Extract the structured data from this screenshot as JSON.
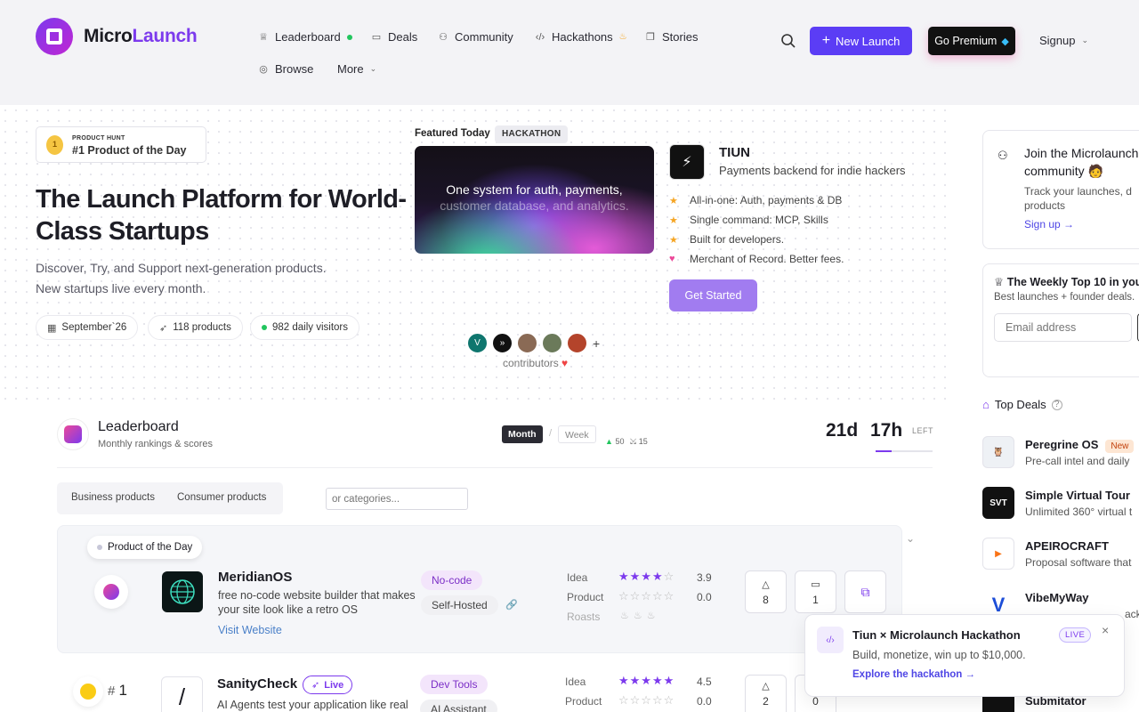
{
  "brand": {
    "name_a": "Micro",
    "name_b": "Launch"
  },
  "nav": {
    "leaderboard": "Leaderboard",
    "deals": "Deals",
    "community": "Community",
    "hackathons": "Hackathons",
    "stories": "Stories",
    "browse": "Browse",
    "more": "More"
  },
  "header_actions": {
    "new_launch": "New Launch",
    "premium": "Go Premium",
    "signup": "Signup"
  },
  "hero": {
    "badge_small": "PRODUCT HUNT",
    "badge_big": "#1 Product of the Day",
    "title": "The Launch Platform for World-Class Startups",
    "sub1": "Discover, Try, and Support next-generation products.",
    "sub2": "New startups live every month.",
    "pill_date": "September`26",
    "pill_products": "118 products",
    "pill_visitors": "982 daily visitors"
  },
  "featured": {
    "label": "Featured Today",
    "tag": "HACKATHON",
    "card_line1": "One system for auth, payments,",
    "card_line2": "customer database, and analytics.",
    "name": "TIUN",
    "desc": "Payments backend for indie hackers",
    "bullets": [
      "All-in-one: Auth, payments & DB",
      "Single command: MCP, Skills",
      "Built for developers.",
      "Merchant of Record. Better fees."
    ],
    "cta": "Get Started",
    "contributors_label": "contributors",
    "avatar_v": "V",
    "plus": "+"
  },
  "sidebar": {
    "join_title": "Join the Microlaunch community",
    "join_desc": "Track your launches, d... products",
    "join_desc_a": "Track your launches, d",
    "join_desc_b": "products",
    "join_link": "Sign up →",
    "weekly_title": "The Weekly Top 10 in you",
    "weekly_desc": "Best launches + founder deals.",
    "email_placeholder": "Email address",
    "top_deals": "Top Deals",
    "deals": [
      {
        "name": "Peregrine OS",
        "desc": "Pre-call intel and daily",
        "tag": "New"
      },
      {
        "name": "Simple Virtual Tour",
        "desc": "Unlimited 360° virtual t"
      },
      {
        "name": "APEIROCRAFT",
        "desc": "Proposal software that"
      },
      {
        "name": "VibeMyWay",
        "desc": "ack"
      },
      {
        "name": "Submitator",
        "desc": ""
      }
    ],
    "deal_logo_svt": "SVT"
  },
  "leaderboard": {
    "title": "Leaderboard",
    "subtitle": "Monthly rankings & scores",
    "month": "Month",
    "sep": "/",
    "week": "Week",
    "up_count": "▲ 50",
    "x_count": "✕ 15",
    "days": "21d",
    "hours": "17h",
    "left": "LEFT",
    "tab_business": "Business products",
    "tab_consumer": "Consumer products",
    "category_placeholder": "or categories...",
    "potd": "Product of the Day",
    "rows": [
      {
        "name": "MeridianOS",
        "desc": "free no-code website builder that makes your site look like a retro OS",
        "desc_a": "free no-code website builder that makes",
        "desc_b": "your site look like a retro OS",
        "visit": "Visit Website",
        "tag1": "No-code",
        "tag2": "Self-Hosted",
        "idea": "Idea",
        "idea_score": "3.9",
        "idea_stars": 4,
        "product": "Product",
        "product_score": "0.0",
        "roasts": "Roasts",
        "upvotes": "8",
        "comments": "1"
      },
      {
        "rank_hash": "#",
        "rank": "1",
        "name": "SanityCheck",
        "live": "Live",
        "desc_a": "AI Agents test your application like real",
        "logo_char": "/",
        "tag1": "Dev Tools",
        "tag2": "AI Assistant",
        "idea": "Idea",
        "idea_score": "4.5",
        "idea_stars": 5,
        "product": "Product",
        "product_score": "0.0",
        "upvotes": "2",
        "comments": "0"
      }
    ]
  },
  "toast": {
    "title": "Tiun × Microlaunch Hackathon",
    "badge": "LIVE",
    "desc": "Build, monetize, win up to $10,000.",
    "link": "Explore the hackathon →"
  },
  "colors": {
    "accent": "#5b3df5",
    "brand": "#7c3aed",
    "star": "#f5a524"
  }
}
